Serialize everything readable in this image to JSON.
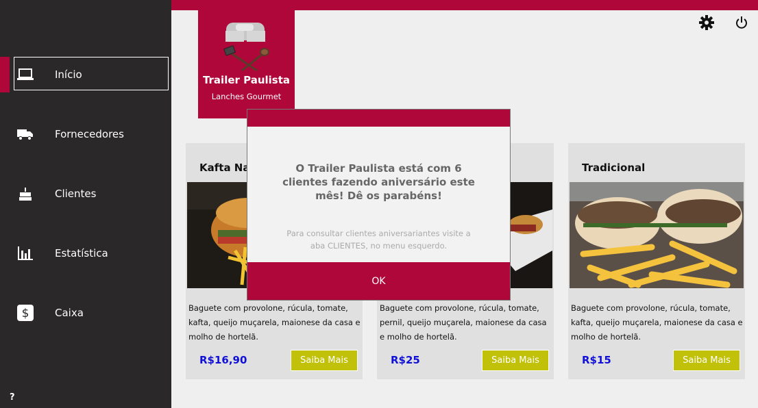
{
  "sidebar": {
    "items": [
      {
        "label": "Início",
        "icon": "laptop-icon"
      },
      {
        "label": "Fornecedores",
        "icon": "truck-icon"
      },
      {
        "label": "Clientes",
        "icon": "cake-icon"
      },
      {
        "label": "Estatística",
        "icon": "bar-chart-icon"
      },
      {
        "label": "Caixa",
        "icon": "dollar-icon"
      }
    ],
    "help_label": "?"
  },
  "header": {
    "icons": [
      "gear-icon",
      "power-icon"
    ]
  },
  "logo": {
    "name": "Trailer Paulista",
    "tagline": "Lanches Gourmet"
  },
  "cards": [
    {
      "title": "Kafta Na",
      "description": "Baguete com provolone, rúcula, tomate, kafta, queijo muçarela, maionese da casa e molho de hortelã.",
      "price": "R$16,90",
      "button_label": "Saiba Mais"
    },
    {
      "title": "",
      "description": "Baguete com provolone, rúcula, tomate, pernil, queijo muçarela, maionese da casa e molho de hortelã.",
      "price": "R$25",
      "button_label": "Saiba Mais"
    },
    {
      "title": "Tradicional",
      "description": "Baguete com provolone, rúcula, tomate, kafta, queijo muçarela, maionese da casa e molho de hortelã.",
      "price": "R$15",
      "button_label": "Saiba Mais"
    }
  ],
  "modal": {
    "heading": "O Trailer Paulista está com 6 clientes fazendo aniversário este mês! Dê os parabéns!",
    "note": "Para consultar clientes aniversariantes visite a aba CLIENTES, no menu esquerdo.",
    "ok_label": "OK"
  },
  "colors": {
    "brand": "#b0073a",
    "sidebar": "#2a2829",
    "button": "#c1c10a",
    "price": "#1010d8"
  }
}
